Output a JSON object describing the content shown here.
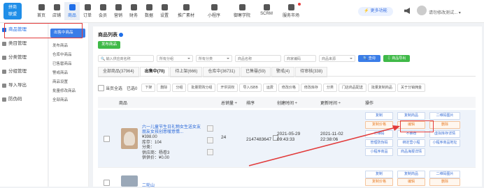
{
  "logo": {
    "line1": "拼商",
    "line2": "联盟"
  },
  "nav": [
    {
      "label": "首页",
      "icon": "home-icon"
    },
    {
      "label": "店铺",
      "icon": "store-icon"
    },
    {
      "label": "商品",
      "icon": "goods-icon",
      "active": true
    },
    {
      "label": "订单",
      "icon": "order-icon"
    },
    {
      "label": "会员",
      "icon": "member-icon"
    },
    {
      "label": "营销",
      "icon": "marketing-icon"
    },
    {
      "label": "财务",
      "icon": "finance-icon"
    },
    {
      "label": "数据",
      "icon": "chart-icon"
    },
    {
      "label": "设置",
      "icon": "settings-icon"
    },
    {
      "label": "推广素材",
      "icon": "share-icon"
    },
    {
      "label": "小程序",
      "icon": "miniprogram-icon"
    },
    {
      "label": "御寒学院",
      "icon": "school-icon"
    },
    {
      "label": "SCRM",
      "icon": "scrm-icon"
    },
    {
      "label": "服务市场",
      "icon": "market-icon"
    }
  ],
  "header": {
    "upgrade": "更多功能",
    "username": "请勿修改测试..."
  },
  "sidebar_primary": [
    {
      "label": "商品管理",
      "active": true
    },
    {
      "label": "类目管理"
    },
    {
      "label": "分类管理"
    },
    {
      "label": "分组管理"
    },
    {
      "label": "导入导出"
    },
    {
      "label": "防伪码"
    }
  ],
  "sidebar_secondary": [
    {
      "label": "出售中商品",
      "active": true
    },
    {
      "label": "发布商品"
    },
    {
      "label": "仓库中商品"
    },
    {
      "label": "已售罄商品"
    },
    {
      "label": "警戒商品"
    },
    {
      "label": "商品设置"
    },
    {
      "label": "批量修改商品"
    },
    {
      "label": "全部商品"
    }
  ],
  "page": {
    "title": "商品列表",
    "publish": "发布商品"
  },
  "filters": {
    "search_placeholder": "输入供应商名称",
    "group1": "所有分组",
    "group2": "所有分类",
    "name_placeholder": "商品名称",
    "code_placeholder": "商家编码",
    "source": "商品来源",
    "search_btn": "查询",
    "export_btn": "商品导出"
  },
  "tabs": [
    {
      "label": "全部商品(37964)"
    },
    {
      "label": "出售中(70)",
      "active": true
    },
    {
      "label": "待上架(666)"
    },
    {
      "label": "仓库中(36731)"
    },
    {
      "label": "已售罄(59)"
    },
    {
      "label": "警戒(4)"
    },
    {
      "label": "待审核(338)"
    }
  ],
  "bulk": {
    "select_page": "当页全选",
    "selected": "已选0",
    "actions": [
      "下架",
      "删除",
      "分组",
      "批量限购分组",
      "开供货权",
      "导入ISBB",
      "运费",
      "修改价格",
      "修改库存",
      "分类",
      "门店商品配送",
      "批量复制商品",
      "关于分销佣金"
    ]
  },
  "columns": {
    "goods": "商品",
    "total_sales": "总销量 ÷",
    "sort": "排序",
    "created": "创建时间 ÷",
    "updated": "更新时间 ÷",
    "ops": "操作"
  },
  "rows": [
    {
      "title": "六一儿童节生日礼物女生送女友朋友女孩创意嗳意情...",
      "price": "¥398.00",
      "stock": "库存：104",
      "category": "分类：",
      "supplier": "供应商：杨卷3",
      "supply_price": "供供价：¥0.00",
      "sales": "24",
      "sort": "2147483647",
      "created_date": "2021-05-29",
      "created_time": "09:43:33",
      "updated_date": "2021-11-02",
      "updated_time": "22:38:06",
      "ops": [
        {
          "label": "复制",
          "style": "blue"
        },
        {
          "label": "复制商品",
          "style": "blue"
        },
        {
          "label": "二维码图片",
          "style": "blue"
        },
        {
          "label": "复制价格",
          "style": "orange"
        },
        {
          "label": "编辑",
          "style": "orange"
        },
        {
          "label": "删除",
          "style": "orange"
        },
        {
          "label": "二维码",
          "style": "blue"
        },
        {
          "label": "不推荐",
          "style": "blue"
        },
        {
          "label": "虚拟库存详情",
          "style": "blue"
        },
        {
          "label": "管理防伪码",
          "style": "blue"
        },
        {
          "label": "绑定营小程",
          "style": "blue"
        },
        {
          "label": "小程序商品地址",
          "style": "blue"
        },
        {
          "label": "小程序商品",
          "style": "blue"
        },
        {
          "label": "商品海报详情",
          "style": "blue"
        }
      ]
    },
    {
      "title": "二轮山",
      "ops": [
        {
          "label": "复制",
          "style": "blue"
        },
        {
          "label": "复制商品",
          "style": "blue"
        },
        {
          "label": "二维码图片",
          "style": "blue"
        },
        {
          "label": "复制价格",
          "style": "orange"
        },
        {
          "label": "编辑",
          "style": "orange"
        },
        {
          "label": "删除",
          "style": "orange"
        }
      ]
    }
  ]
}
